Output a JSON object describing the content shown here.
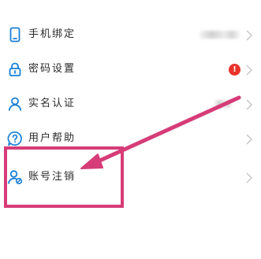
{
  "colors": {
    "icon_blue": "#1a7fd6",
    "label_text": "#2a2a2a",
    "chevron_gray": "#c8c8c8",
    "alert_red": "#e8332a",
    "annotation_pink": "#d63c78"
  },
  "menu": {
    "items": [
      {
        "label": "手机绑定",
        "icon": "phone-icon"
      },
      {
        "label": "密码设置",
        "icon": "lock-icon",
        "badge": "!"
      },
      {
        "label": "实名认证",
        "icon": "person-icon"
      },
      {
        "label": "用户帮助",
        "icon": "help-icon"
      },
      {
        "label": "账号注销",
        "icon": "person-remove-icon"
      }
    ]
  },
  "annotation": {
    "type": "highlight-with-arrow",
    "target": "账号注销"
  }
}
